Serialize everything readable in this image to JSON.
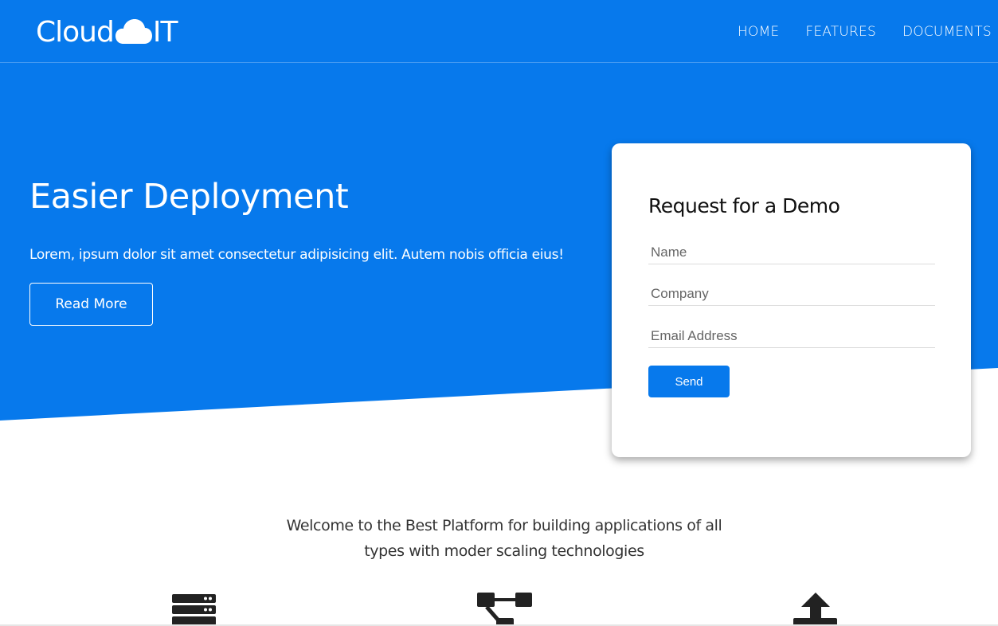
{
  "brand": {
    "prefix": "Cloud",
    "suffix": "IT",
    "icon": "cloud-icon"
  },
  "nav": {
    "items": [
      "HOME",
      "FEATURES",
      "DOCUMENTS"
    ]
  },
  "hero": {
    "title": "Easier Deployment",
    "text": "Lorem, ipsum dolor sit amet consectetur adipisicing elit. Autem nobis officia eius!",
    "button_label": "Read More",
    "background_color": "#0779ec"
  },
  "demo_form": {
    "title": "Request for a Demo",
    "name_placeholder": "Name",
    "company_placeholder": "Company",
    "email_placeholder": "Email Address",
    "send_label": "Send"
  },
  "welcome_text": "Welcome to the Best Platform for building applications of all types with moder scaling technologies",
  "features": {
    "icons": [
      "server-icon",
      "network-icon",
      "upload-icon"
    ]
  }
}
